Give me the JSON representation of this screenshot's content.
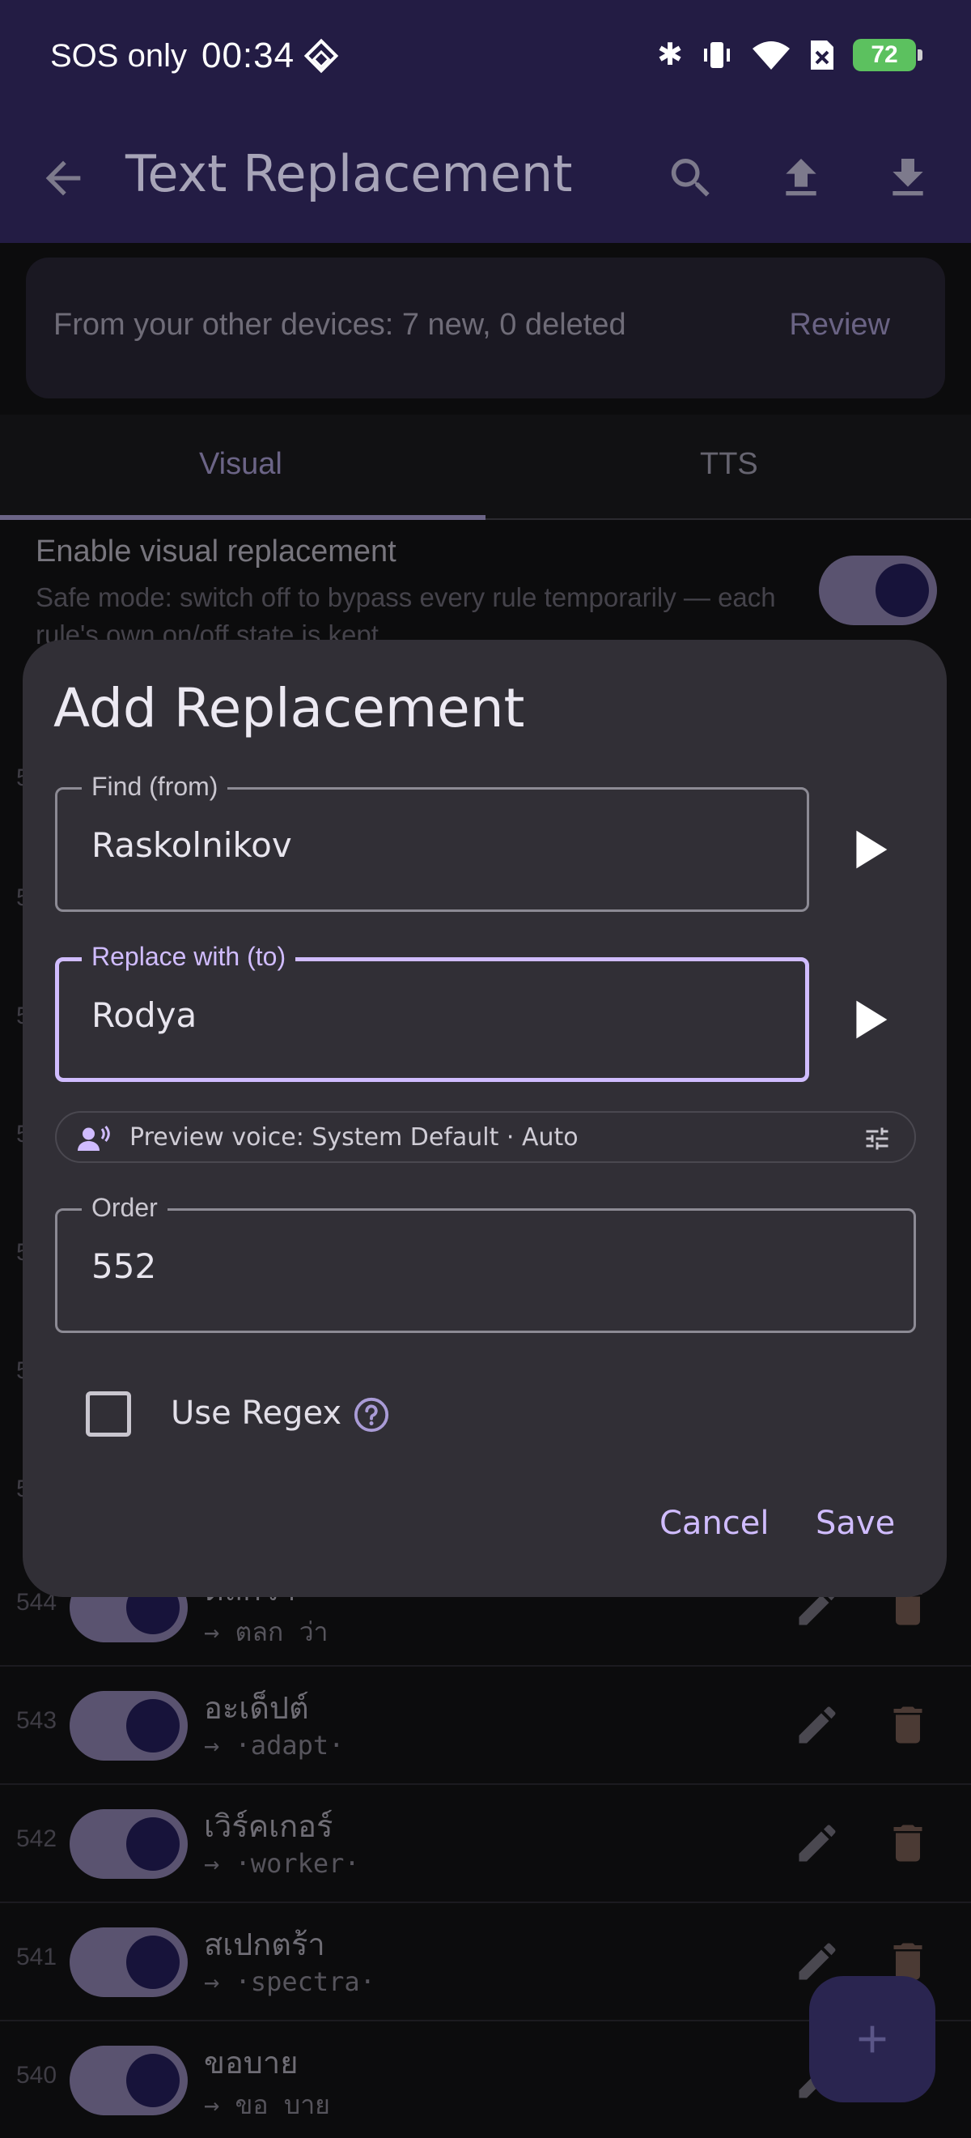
{
  "status_bar": {
    "carrier": "SOS only",
    "time": "00:34",
    "battery": "72"
  },
  "app_bar": {
    "title": "Text Replacement",
    "icons": [
      "back-arrow-icon",
      "search-icon",
      "upload-icon",
      "download-icon"
    ]
  },
  "sync_banner": {
    "text": "From your other devices: 7 new, 0 deleted",
    "action": "Review"
  },
  "tabs": [
    {
      "label": "Visual",
      "selected": true
    },
    {
      "label": "TTS",
      "selected": false
    }
  ],
  "visual_settings": {
    "title": "Enable visual replacement",
    "subtitle": "Safe mode: switch off to bypass every rule temporarily — each rule's own on/off state is kept.",
    "enabled": true
  },
  "partial_rule_numbers": [
    "5",
    "5",
    "5",
    "5",
    "5",
    "5",
    "5"
  ],
  "rules": [
    {
      "order": "544",
      "from": "ตลกว่า",
      "to": "→ ตลก ว่า",
      "enabled": true
    },
    {
      "order": "543",
      "from": "อะเด็ปต์",
      "to": "→ ·adapt·",
      "enabled": true
    },
    {
      "order": "542",
      "from": "เวิร์คเกอร์",
      "to": "→ ·worker·",
      "enabled": true
    },
    {
      "order": "541",
      "from": "สเปกตร้า",
      "to": "→ ·spectra·",
      "enabled": true
    },
    {
      "order": "540",
      "from": "ขอบาย",
      "to": "→ ขอ บาย",
      "enabled": true
    }
  ],
  "dialog": {
    "title": "Add Replacement",
    "find_label": "Find (from)",
    "find_value": "Raskolnikov",
    "replace_label": "Replace with (to)",
    "replace_value": "Rodya",
    "voice_preview": "Preview voice: System Default · Auto",
    "order_label": "Order",
    "order_value": "552",
    "use_regex_label": "Use Regex",
    "use_regex_checked": false,
    "cancel_label": "Cancel",
    "save_label": "Save"
  },
  "colors": {
    "accent": "#d0bcff",
    "app_bar": "#231c44",
    "dialog_bg": "#312f36"
  }
}
